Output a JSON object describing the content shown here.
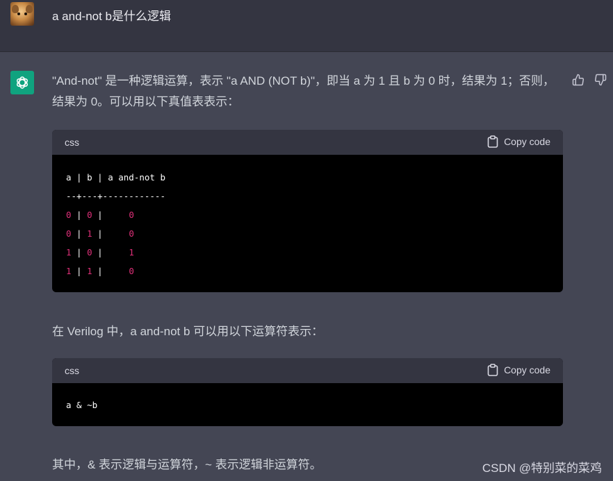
{
  "user": {
    "message": "a and-not b是什么逻辑"
  },
  "assistant": {
    "para1": "\"And-not\" 是一种逻辑运算，表示 \"a AND (NOT b)\"，即当 a 为 1 且 b 为 0 时，结果为 1；否则，结果为 0。可以用以下真值表表示：",
    "code1": {
      "lang": "css",
      "copy_label": "Copy code",
      "header_line": "a | b | a and-not b",
      "separator_line": "--+---+------------",
      "rows": [
        {
          "a": "0",
          "b": "0",
          "r": "0"
        },
        {
          "a": "0",
          "b": "1",
          "r": "0"
        },
        {
          "a": "1",
          "b": "0",
          "r": "1"
        },
        {
          "a": "1",
          "b": "1",
          "r": "0"
        }
      ]
    },
    "para2": "在 Verilog 中，a and-not b 可以用以下运算符表示：",
    "code2": {
      "lang": "css",
      "copy_label": "Copy code",
      "line": "a & ~b"
    },
    "para3": "其中，& 表示逻辑与运算符，~ 表示逻辑非运算符。"
  },
  "watermark": "CSDN @特别菜的菜鸡",
  "colors": {
    "accent_green": "#10a37f",
    "code_number": "#df3079",
    "panel_bg": "#444654",
    "user_bg": "#343541"
  }
}
